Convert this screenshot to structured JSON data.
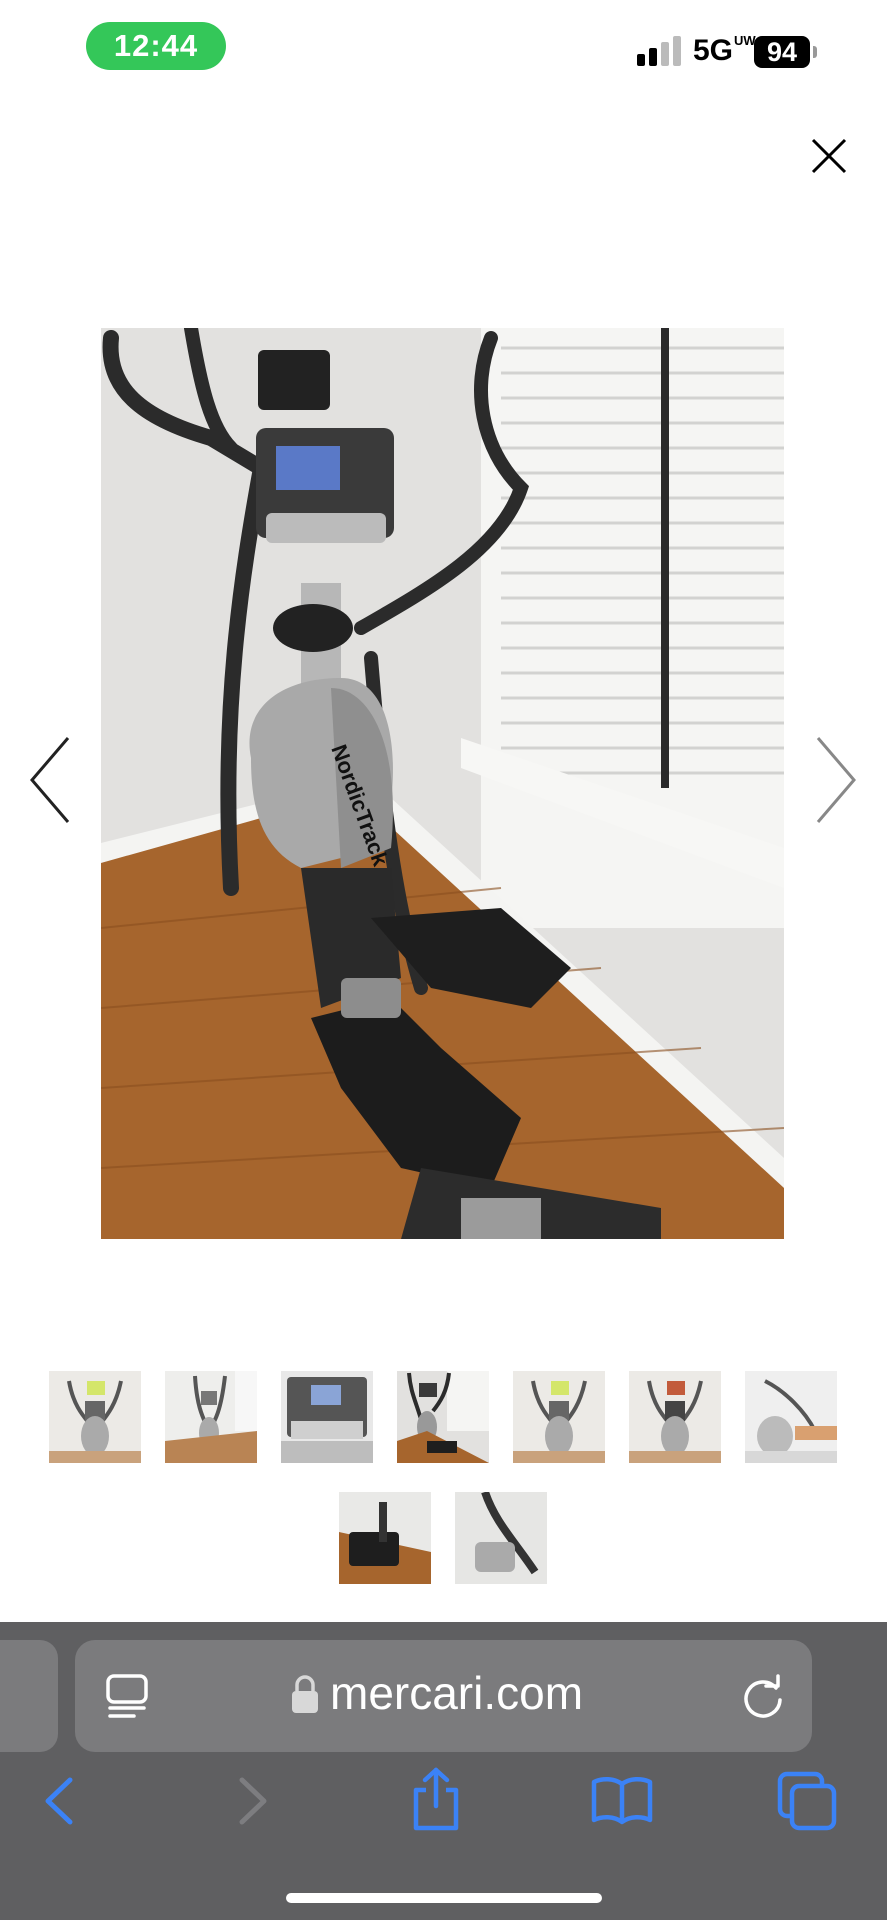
{
  "status_bar": {
    "time": "12:44",
    "network": "5G",
    "network_sup": "UW",
    "battery": "94"
  },
  "gallery": {
    "main_image_alt": "NordicTrack",
    "thumbnail_count": 9,
    "selected_index": 3
  },
  "browser": {
    "url": "mercari.com",
    "accent_color": "#3b82f6"
  },
  "icons": [
    "close-icon",
    "chevron-left-icon",
    "chevron-right-icon",
    "reader-icon",
    "lock-icon",
    "reload-icon",
    "back-icon",
    "forward-icon",
    "share-icon",
    "bookmarks-icon",
    "tabs-icon"
  ]
}
